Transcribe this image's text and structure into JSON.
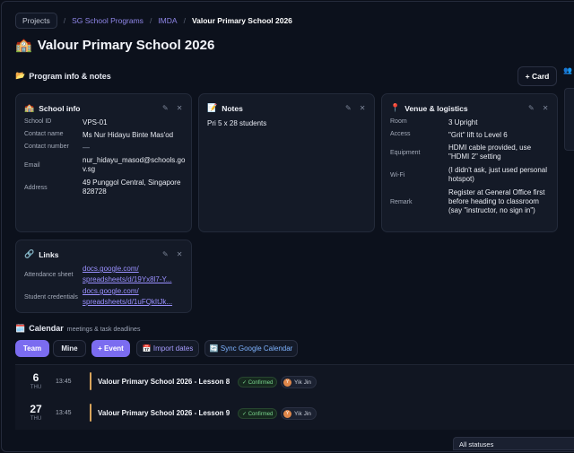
{
  "breadcrumb": {
    "root": "Projects",
    "program": "SG School Programs",
    "org": "IMDA",
    "current": "Valour Primary School 2026"
  },
  "page": {
    "title_icon": "🏫",
    "title": "Valour Primary School 2026"
  },
  "section": {
    "icon": "📂",
    "title": "Program info & notes",
    "add_card_label": "+ Card"
  },
  "school_info": {
    "icon": "🏫",
    "title": "School info",
    "rows": [
      {
        "key": "School ID",
        "value": "VPS-01"
      },
      {
        "key": "Contact name",
        "value": "Ms Nur Hidayu Binte Mas'od"
      },
      {
        "key": "Contact number",
        "value": "—"
      },
      {
        "key": "Email",
        "value": "nur_hidayu_masod@schools.gov.sg"
      },
      {
        "key": "Address",
        "value": "49 Punggol Central, Singapore 828728"
      }
    ]
  },
  "notes": {
    "icon": "📝",
    "title": "Notes",
    "text": "Pri 5 x 28 students"
  },
  "venue": {
    "icon": "📍",
    "title": "Venue & logistics",
    "rows": [
      {
        "key": "Room",
        "value": "3 Upright"
      },
      {
        "key": "Access",
        "value": "\"Grit\" lift to Level 6"
      },
      {
        "key": "Equipment",
        "value": "HDMI cable provided, use \"HDMI 2\" setting"
      },
      {
        "key": "Wi-Fi",
        "value": "(I didn't ask, just used personal hotspot)"
      },
      {
        "key": "Remark",
        "value": "Register at General Office first before heading to classroom (say \"instructor, no sign in\")"
      }
    ]
  },
  "links": {
    "icon": "🔗",
    "title": "Links",
    "rows": [
      {
        "key": "Attendance sheet",
        "line1": "docs.google.com/",
        "line2": "spreadsheets/d/19Yx8l7-Y..."
      },
      {
        "key": "Student credentials",
        "line1": "docs.google.com/",
        "line2": "spreadsheets/d/1uFQkItJk..."
      }
    ]
  },
  "calendar": {
    "icon": "🗓️",
    "title": "Calendar",
    "subtitle": "meetings & task deadlines",
    "buttons": {
      "team": "Team",
      "mine": "Mine",
      "event": "+ Event",
      "import": "📅 Import dates",
      "sync": "🔄 Sync Google Calendar"
    },
    "events": [
      {
        "day": "6",
        "weekday": "THU",
        "time": "13:45",
        "name": "Valour Primary School 2026 - Lesson 8",
        "status": "✓ Confirmed",
        "person": "Yik Jin",
        "initial": "Y"
      },
      {
        "day": "27",
        "weekday": "THU",
        "time": "13:45",
        "name": "Valour Primary School 2026 - Lesson 9",
        "status": "✓ Confirmed",
        "person": "Yik Jin",
        "initial": "Y"
      }
    ],
    "status_filter": "All statuses"
  },
  "colors": {
    "accent": "#7b6cf0",
    "event_bar": "#d9a55c",
    "confirmed": "#7bd88f"
  }
}
